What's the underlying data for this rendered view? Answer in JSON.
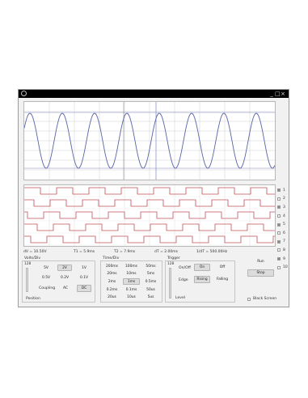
{
  "window": {
    "app_icon": "oscilloscope-icon",
    "controls": [
      "_",
      "□",
      "×"
    ]
  },
  "readouts": {
    "dv": "dV = 10.50V",
    "t1": "T1 = 5.9ms",
    "t2": "T2 = 7.9ms",
    "dt": "dT = 2.00ms",
    "freq": "1/dT = 500.00Hz"
  },
  "channels": [
    {
      "label": "1",
      "checked": true
    },
    {
      "label": "2",
      "checked": false
    },
    {
      "label": "3",
      "checked": true
    },
    {
      "label": "4",
      "checked": false
    },
    {
      "label": "5",
      "checked": true
    },
    {
      "label": "6",
      "checked": false
    },
    {
      "label": "7",
      "checked": true
    },
    {
      "label": "8",
      "checked": false
    },
    {
      "label": "9",
      "checked": true
    },
    {
      "label": "10",
      "checked": false
    }
  ],
  "volts_div": {
    "title": "Volts/Div",
    "slider_value": "128",
    "options": [
      "5V",
      "2V",
      "1V",
      "0.5V",
      "0.2V",
      "0.1V"
    ],
    "selected": "2V",
    "coupling_label": "Coupling",
    "coupling_options": [
      "AC",
      "DC"
    ],
    "coupling_selected": "DC",
    "position_label": "Position"
  },
  "time_div": {
    "title": "Time/Div",
    "options": [
      "200ms",
      "100ms",
      "50ms",
      "20ms",
      "10ms",
      "5ms",
      "2ms",
      "1ms",
      "0.5ms",
      "0.2ms",
      "0.1ms",
      "50us",
      "20us",
      "10us",
      "5us"
    ],
    "selected": "1ms"
  },
  "trigger": {
    "title": "Trigger",
    "slider_value": "128",
    "onoff_label": "On/Off",
    "on_label": "On",
    "off_label": "Off",
    "onoff_selected": "On",
    "edge_label": "Edge",
    "rising_label": "Rising",
    "falling_label": "Falling",
    "edge_selected": "Rising",
    "level_label": "Level"
  },
  "actions": {
    "run_label": "Run",
    "stop_label": "Stop",
    "black_screen_label": "Black Screen",
    "black_screen_checked": false
  },
  "colors": {
    "analog_trace": "#5a63a8",
    "digital_trace": "#c0505a",
    "grid": "#cfcfcf",
    "cursor": "#7f86c2"
  }
}
